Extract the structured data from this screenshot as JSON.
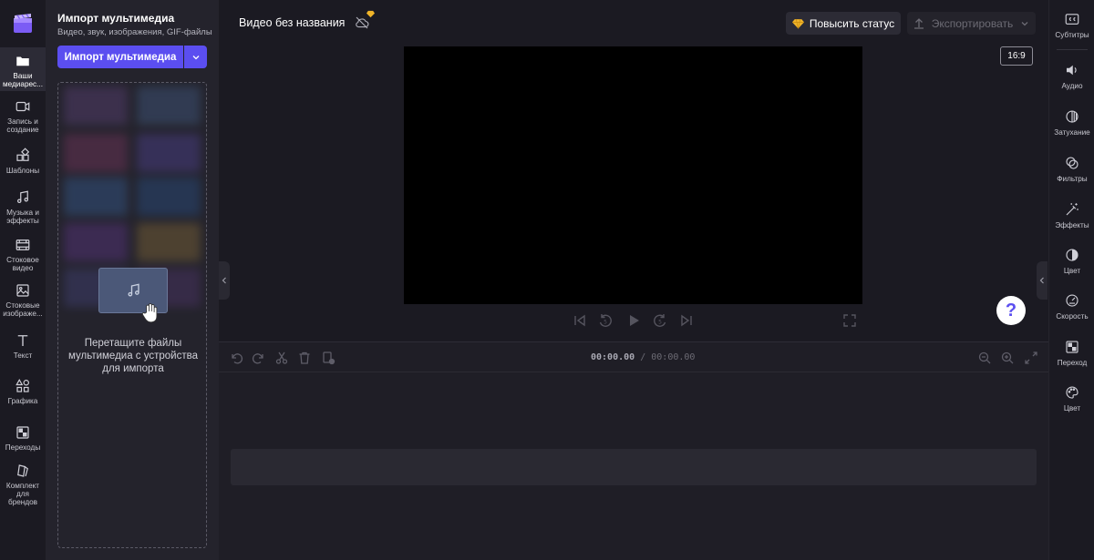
{
  "left_rail": {
    "items": [
      {
        "label": "Ваши медиарес...",
        "icon": "folder-icon"
      },
      {
        "label": "Запись и создание",
        "icon": "camera-icon"
      },
      {
        "label": "Шаблоны",
        "icon": "templates-icon"
      },
      {
        "label": "Музыка и эффекты",
        "icon": "music-icon"
      },
      {
        "label": "Стоковое видео",
        "icon": "film-icon"
      },
      {
        "label": "Стоковые изображе...",
        "icon": "image-icon"
      },
      {
        "label": "Текст",
        "icon": "text-icon"
      },
      {
        "label": "Графика",
        "icon": "shapes-icon"
      },
      {
        "label": "Переходы",
        "icon": "transition-icon"
      },
      {
        "label": "Комплект для брендов",
        "icon": "brand-kit-icon"
      }
    ]
  },
  "media_panel": {
    "title": "Импорт мультимедиа",
    "subtitle": "Видео, звук, изображения, GIF-файлы",
    "import_button": "Импорт мультимедиа",
    "drop_text": "Перетащите файлы мультимедиа с устройства для импорта"
  },
  "top_bar": {
    "project_title": "Видео без названия",
    "upgrade_label": "Повысить статус",
    "export_label": "Экспортировать"
  },
  "preview": {
    "aspect_ratio": "16:9",
    "help": "?"
  },
  "timeline": {
    "current_time": "00:00.00",
    "separator": "/",
    "total_time": "00:00.00"
  },
  "right_rail": {
    "items": [
      {
        "label": "Субтитры",
        "icon": "captions-icon"
      },
      {
        "label": "Аудио",
        "icon": "speaker-icon"
      },
      {
        "label": "Затухание",
        "icon": "fade-icon"
      },
      {
        "label": "Фильтры",
        "icon": "filters-icon"
      },
      {
        "label": "Эффекты",
        "icon": "magic-wand-icon"
      },
      {
        "label": "Цвет",
        "icon": "contrast-icon"
      },
      {
        "label": "Скорость",
        "icon": "speedometer-icon"
      },
      {
        "label": "Переход",
        "icon": "transition-icon"
      },
      {
        "label": "Цвет",
        "icon": "palette-icon"
      }
    ]
  },
  "colors": {
    "accent": "#5b4ef0",
    "background": "#1b1a22",
    "panel": "#24232c",
    "gem": "#f0b429"
  }
}
